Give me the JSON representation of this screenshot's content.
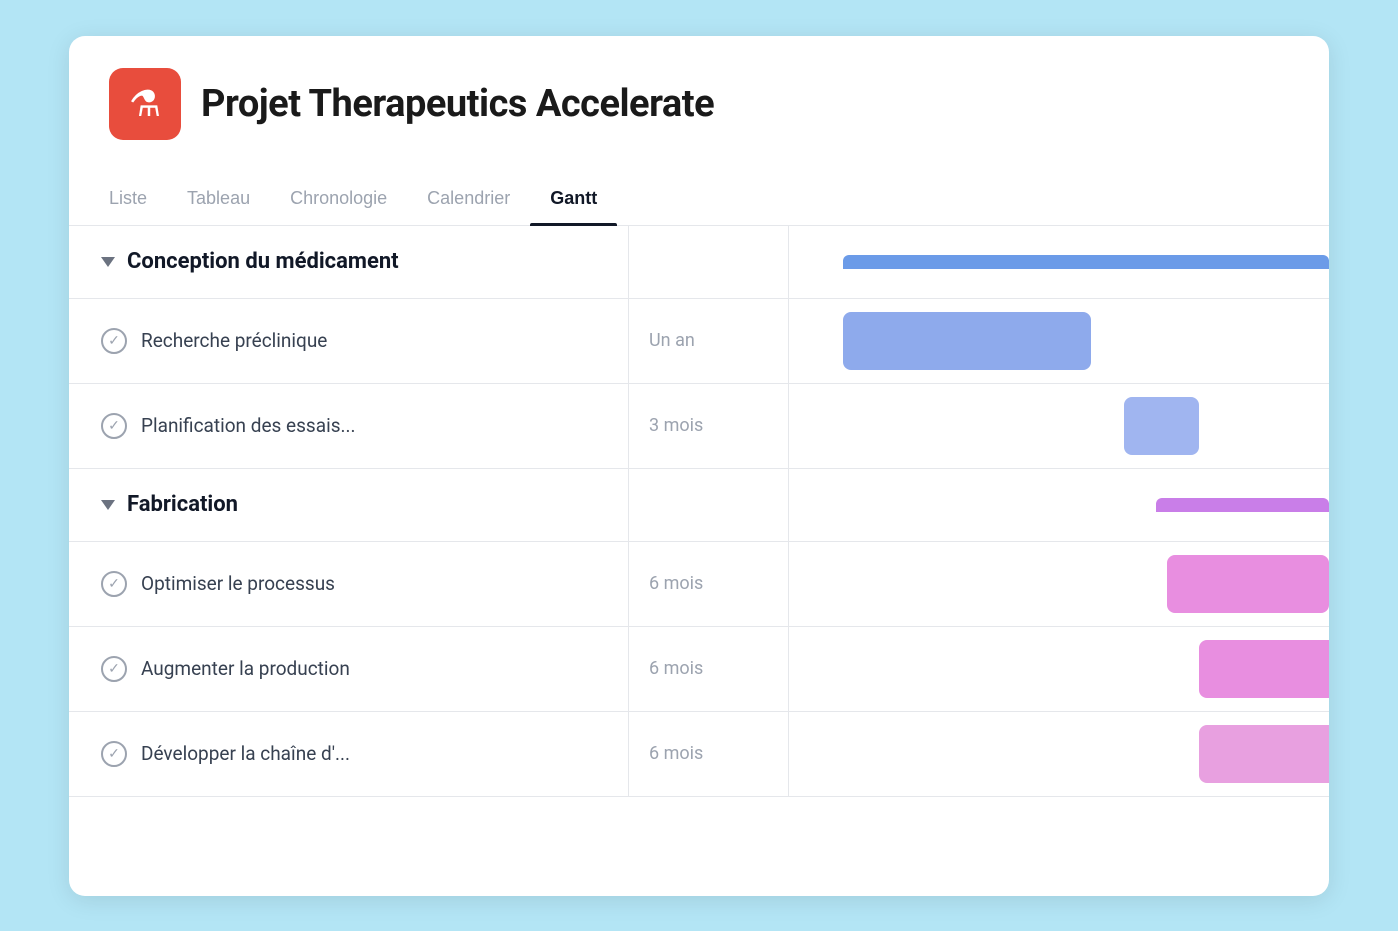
{
  "app": {
    "background": "#b3e5f5"
  },
  "header": {
    "logo_icon": "⚗",
    "logo_bg": "#e84d3d",
    "title": "Projet Therapeutics Accelerate"
  },
  "tabs": [
    {
      "id": "liste",
      "label": "Liste",
      "active": false
    },
    {
      "id": "tableau",
      "label": "Tableau",
      "active": false
    },
    {
      "id": "chronologie",
      "label": "Chronologie",
      "active": false
    },
    {
      "id": "calendrier",
      "label": "Calendrier",
      "active": false
    },
    {
      "id": "gantt",
      "label": "Gantt",
      "active": true
    }
  ],
  "groups": [
    {
      "id": "conception",
      "name": "Conception du médicament",
      "bar_color": "#6b9be8",
      "tasks": [
        {
          "id": "t1",
          "name": "Recherche préclinique",
          "duration": "Un an",
          "bar_color": "#8eaaec",
          "bar_start_pct": 10,
          "bar_width_pct": 46
        },
        {
          "id": "t2",
          "name": "Planification des essais...",
          "duration": "3 mois",
          "bar_color": "#a0b5f0",
          "bar_start_pct": 62,
          "bar_width_pct": 14
        }
      ]
    },
    {
      "id": "fabrication",
      "name": "Fabrication",
      "bar_color": "#c97ee8",
      "tasks": [
        {
          "id": "t3",
          "name": "Optimiser le processus",
          "duration": "6 mois",
          "bar_color": "#e88ee0",
          "bar_start_pct": 72,
          "bar_width_pct": 28
        },
        {
          "id": "t4",
          "name": "Augmenter la production",
          "duration": "6 mois",
          "bar_color": "#e88ee0",
          "bar_start_pct": 78,
          "bar_width_pct": 28
        },
        {
          "id": "t5",
          "name": "Développer la chaîne d'...",
          "duration": "6 mois",
          "bar_color": "#e88ee0",
          "bar_start_pct": 78,
          "bar_width_pct": 28
        }
      ]
    }
  ],
  "icons": {
    "chevron": "▼",
    "check": "✓",
    "flask": "⚗"
  }
}
